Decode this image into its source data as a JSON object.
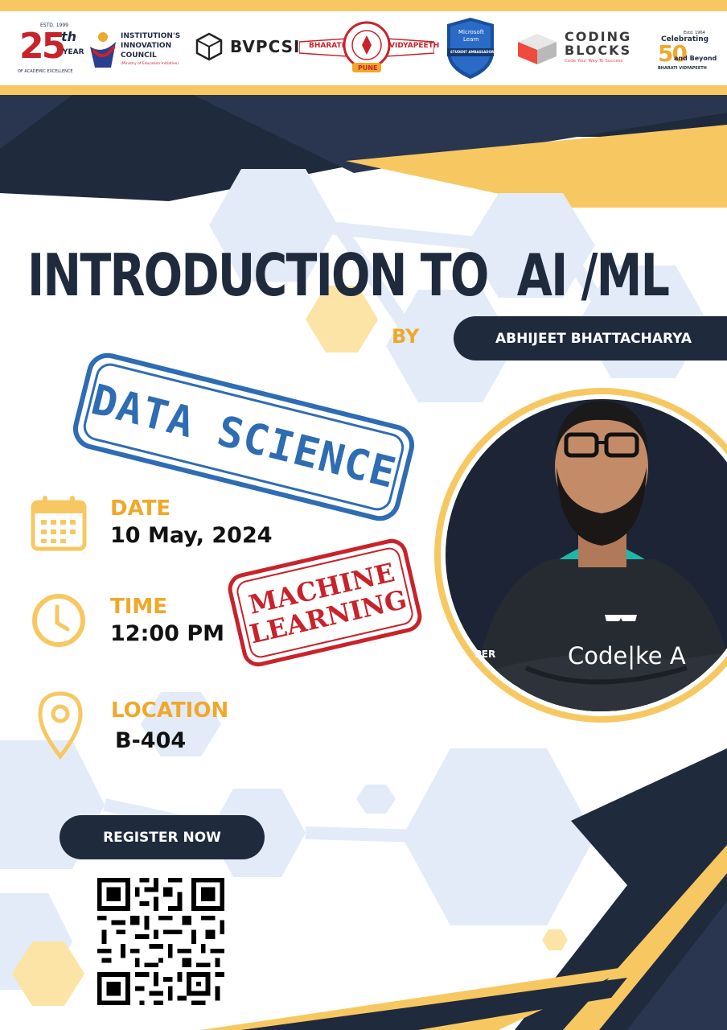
{
  "logos": {
    "anniversary": {
      "number": "25",
      "suffix": "th",
      "word": "YEAR",
      "est": "ESTD. 1999",
      "caption": "OF ACADEMIC EXCELLENCE"
    },
    "iic": {
      "line1": "INSTITUTION'S",
      "line2": "INNOVATION",
      "line3": "COUNCIL",
      "sub": "(Ministry of Education Initiative)"
    },
    "bvpcsi": "BVPCSI",
    "bharati": {
      "left": "BHARATI",
      "right": "VIDYAPEETH",
      "center": "PUNE"
    },
    "microsoft": {
      "line1": "Microsoft",
      "line2": "Learn",
      "band": "STUDENT AMBASSADOR"
    },
    "coding_blocks": {
      "line1": "CODING",
      "line2": "BLOCKS",
      "tagline": "Code Your Way To Success"
    },
    "celebrating": {
      "est": "Estd. 1964",
      "top": "Celebrating",
      "num": "50",
      "bottom": "and Beyond",
      "name": "BHARATI VIDYAPEETH"
    }
  },
  "title": "INTRODUCTION TO  AI /ML",
  "by_label": "BY",
  "speaker": "ABHIJEET BHATTACHARYA",
  "stamps": {
    "data_science": "DATA SCIENCE",
    "ml_line1": "MACHINE",
    "ml_line2": "LEARNING"
  },
  "date": {
    "label": "DATE",
    "value": "10 May, 2024"
  },
  "time": {
    "label": "TIME",
    "value": "12:00 PM"
  },
  "location": {
    "label": "LOCATION",
    "value": "B-404"
  },
  "register_label": "REGISTER NOW",
  "shirt_text": "Code|ke A",
  "sleeve_text": "PER",
  "colors": {
    "navy": "#1f2a3d",
    "gold": "#f0a82a",
    "pale_blue": "#dfe7f7",
    "blue_stamp": "#2e6cb3",
    "red_stamp": "#c8232b",
    "teal": "#20b7a8"
  }
}
